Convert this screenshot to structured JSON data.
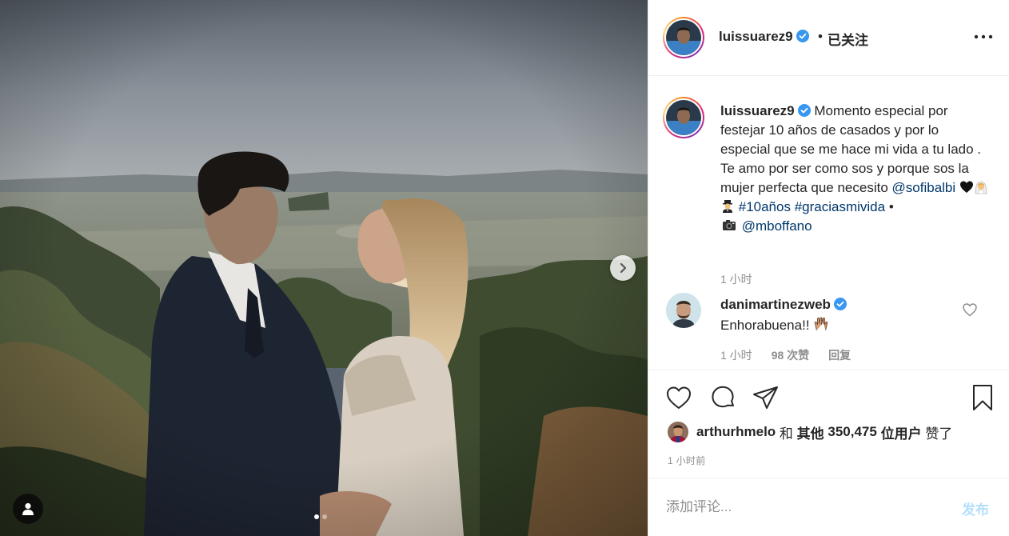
{
  "colors": {
    "accent": "#0095f6",
    "link": "#00376b",
    "post_disabled": "#b2dffc",
    "meta_gray": "#8e8e8e",
    "verified": "#3897f0"
  },
  "photo": {
    "carousel": {
      "total": 2,
      "current": 1
    },
    "icons": {
      "next": "chevron-right-icon",
      "tagged_users": "user-icon"
    }
  },
  "header": {
    "username": "luissuarez9",
    "verified": true,
    "separator": "•",
    "follow_status": "已关注",
    "more_icon": "ellipsis-icon"
  },
  "caption": {
    "username": "luissuarez9",
    "text_1": "Momento especial por festejar 10 años de casados y por lo especial que se me hace mi vida a tu lado . Te amo por ser como sos y porque sos la mujer perfecta que necesito",
    "mention_1": "@sofibalbi",
    "emojis_1": [
      "black-heart-icon",
      "bride-icon",
      "groom-icon"
    ],
    "hashtag_1": "#10años",
    "hashtag_2": "#graciasmivida",
    "bullet": "•",
    "camera_icon": "camera-icon",
    "mention_2": "@mboffano",
    "time": "1 小时"
  },
  "comment": {
    "username": "danimartinezweb",
    "verified": true,
    "text": "Enhorabuena!!",
    "emoji": "clapping-hands-icon",
    "time": "1 小时",
    "likes": "98 次赞",
    "reply": "回复"
  },
  "actions": {
    "like": "heart-icon",
    "comment": "comment-icon",
    "share": "paper-plane-icon",
    "save": "bookmark-icon"
  },
  "likes": {
    "first_user": "arthurhmelo",
    "and": "和",
    "others_label": "其他",
    "count": "350,475",
    "users_label": "位用户",
    "suffix": "赞了",
    "time_ago": "1 小时前"
  },
  "add_comment": {
    "placeholder": "添加评论...",
    "post_label": "发布"
  }
}
